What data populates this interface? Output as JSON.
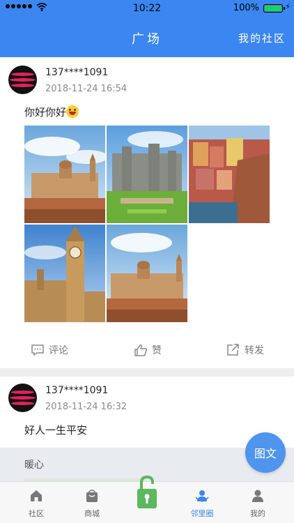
{
  "status_bar": {
    "time": "10:22",
    "battery": "100%",
    "signal_dots": 5,
    "battery_level": 1.0
  },
  "header": {
    "title": "广场",
    "right_link": "我的社区"
  },
  "posts": [
    {
      "username": "137****1091",
      "timestamp": "2018-11-24 16:54",
      "text": "你好你好",
      "emoji": "smiling-face-emoji",
      "photo_count": 5,
      "actions": {
        "comment": "评论",
        "like": "赞",
        "share": "转发"
      }
    },
    {
      "username": "137****1091",
      "timestamp": "2018-11-24 16:32",
      "text": "好人一生平安",
      "sub_label": "暖心"
    }
  ],
  "fab": {
    "label": "图文"
  },
  "tabbar": {
    "items": [
      {
        "label": "社区",
        "icon": "home-icon"
      },
      {
        "label": "商城",
        "icon": "shopping-bag-icon"
      },
      {
        "label": "",
        "icon": "unlock-icon"
      },
      {
        "label": "邻里圈",
        "icon": "neighbors-icon"
      },
      {
        "label": "我的",
        "icon": "person-icon"
      }
    ],
    "active_index": 3
  },
  "colors": {
    "brand": "#3b86f0",
    "fab": "#4f95ee",
    "lock": "#5bb85d"
  }
}
